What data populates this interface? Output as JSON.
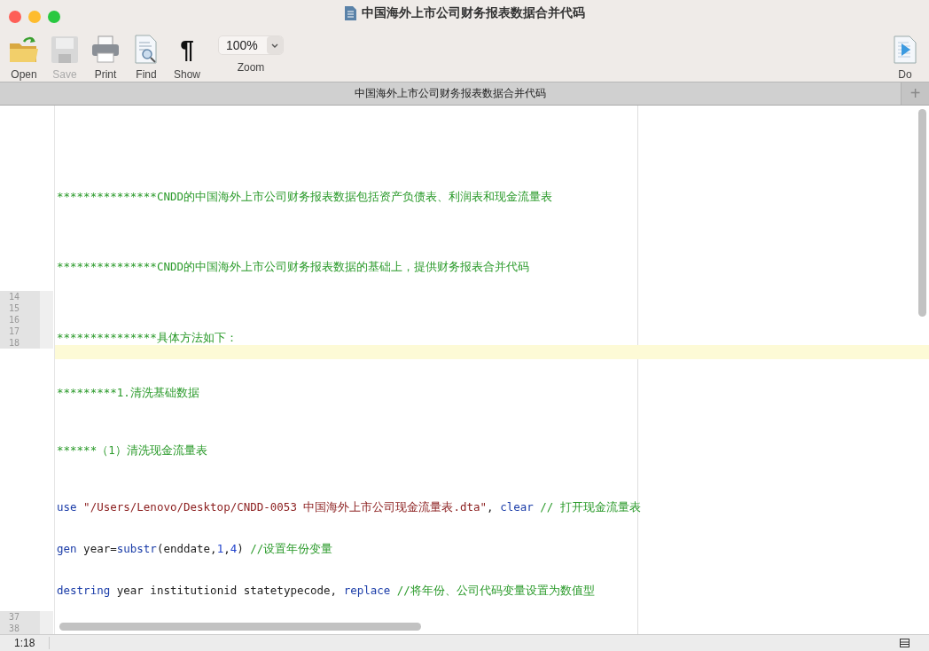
{
  "window": {
    "title": "中国海外上市公司财务报表数据合并代码"
  },
  "toolbar": {
    "items": [
      {
        "kind": "open",
        "label": "Open",
        "disabled": false
      },
      {
        "kind": "save",
        "label": "Save",
        "disabled": true
      },
      {
        "kind": "print",
        "label": "Print",
        "disabled": false
      },
      {
        "kind": "find",
        "label": "Find",
        "disabled": false
      },
      {
        "kind": "show",
        "label": "Show",
        "glyph": "¶",
        "disabled": false
      }
    ],
    "zoom": {
      "value": "100%",
      "label": "Zoom"
    },
    "do": {
      "label": "Do"
    }
  },
  "tab": {
    "title": "中国海外上市公司财务报表数据合并代码",
    "add": "+"
  },
  "editor": {
    "line_number_groups": [
      [
        "14",
        "15",
        "16",
        "17",
        "18"
      ],
      [
        "37",
        "38"
      ]
    ],
    "lines": [
      {
        "kind": "text",
        "tokens": [
          {
            "kind": "comment",
            "text": "***************CNDD的中国海外上市公司财务报表数据包括资产负债表、利润表和现金流量表"
          }
        ]
      },
      {
        "kind": "text",
        "tokens": [
          {
            "kind": "comment",
            "text": "***************CNDD的中国海外上市公司财务报表数据的基础上，提供财务报表合并代码"
          }
        ]
      },
      {
        "kind": "text",
        "tokens": [
          {
            "kind": "comment",
            "text": "***************具体方法如下："
          }
        ]
      },
      {
        "kind": "current"
      },
      {
        "kind": "text",
        "tokens": [
          {
            "kind": "comment",
            "text": "*********1.清洗基础数据"
          }
        ]
      },
      {
        "kind": "text",
        "tokens": [
          {
            "kind": "comment",
            "text": "******（1）清洗现金流量表"
          }
        ]
      },
      {
        "kind": "text",
        "tokens": [
          {
            "kind": "keyword",
            "text": "use"
          },
          {
            "kind": "string",
            "text": " \"/Users/Lenovo/Desktop/CNDD-0053 中国海外上市公司现金流量表.dta\""
          },
          {
            "kind": "plain",
            "text": ", "
          },
          {
            "kind": "keyword",
            "text": "clear"
          },
          {
            "kind": "comment",
            "text": " // 打开现金流量表"
          }
        ]
      },
      {
        "kind": "text",
        "tokens": [
          {
            "kind": "keyword",
            "text": "gen"
          },
          {
            "kind": "plain",
            "text": " year="
          },
          {
            "kind": "keyword",
            "text": "substr"
          },
          {
            "kind": "plain",
            "text": "(enddate,"
          },
          {
            "kind": "number",
            "text": "1"
          },
          {
            "kind": "plain",
            "text": ","
          },
          {
            "kind": "number",
            "text": "4"
          },
          {
            "kind": "plain",
            "text": ") "
          },
          {
            "kind": "comment",
            "text": "//设置年份变量"
          }
        ]
      },
      {
        "kind": "text",
        "tokens": [
          {
            "kind": "keyword",
            "text": "destring"
          },
          {
            "kind": "plain",
            "text": " year institutionid statetypecode, "
          },
          {
            "kind": "keyword",
            "text": "replace"
          },
          {
            "kind": "comment",
            "text": " //将年份、公司代码变量设置为数值型"
          }
        ]
      }
    ]
  },
  "status_bar": {
    "position": "1:18"
  }
}
